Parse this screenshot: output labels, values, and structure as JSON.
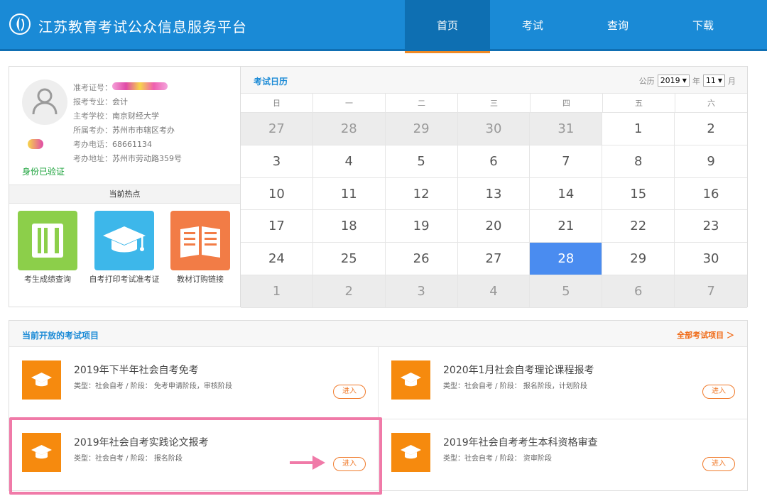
{
  "header": {
    "title": "江苏教育考试公众信息服务平台",
    "nav": [
      "首页",
      "考试",
      "查询",
      "下载"
    ],
    "active_nav": 0,
    "brand_color": "#1a8ad6"
  },
  "profile": {
    "fields": [
      {
        "label": "准考证号：",
        "value": ""
      },
      {
        "label": "报考专业：",
        "value": "会计"
      },
      {
        "label": "主考学校：",
        "value": "南京财经大学"
      },
      {
        "label": "所属考办：",
        "value": "苏州市市辖区考办"
      },
      {
        "label": "考办电话：",
        "value": "68661134"
      },
      {
        "label": "考办地址：",
        "value": "苏州市劳动路359号"
      }
    ],
    "verified": "身份已验证",
    "hot_title": "当前热点",
    "hot_items": [
      {
        "label": "考生成绩查询",
        "icon": "notebook-icon",
        "color": "#8ccf4a"
      },
      {
        "label": "自考打印考试准考证",
        "icon": "graduation-cap-icon",
        "color": "#3db7ea"
      },
      {
        "label": "教材订购链接",
        "icon": "open-book-icon",
        "color": "#f27c46"
      }
    ]
  },
  "calendar": {
    "title": "考试日历",
    "calendar_type": "公历",
    "year": "2019",
    "year_suffix": "年",
    "month": "11",
    "month_suffix": "月",
    "weekdays": [
      "日",
      "一",
      "二",
      "三",
      "四",
      "五",
      "六"
    ],
    "days": [
      {
        "d": "27",
        "t": "other"
      },
      {
        "d": "28",
        "t": "other"
      },
      {
        "d": "29",
        "t": "other"
      },
      {
        "d": "30",
        "t": "other"
      },
      {
        "d": "31",
        "t": "other"
      },
      {
        "d": "1",
        "t": ""
      },
      {
        "d": "2",
        "t": ""
      },
      {
        "d": "3",
        "t": ""
      },
      {
        "d": "4",
        "t": ""
      },
      {
        "d": "5",
        "t": ""
      },
      {
        "d": "6",
        "t": ""
      },
      {
        "d": "7",
        "t": ""
      },
      {
        "d": "8",
        "t": ""
      },
      {
        "d": "9",
        "t": ""
      },
      {
        "d": "10",
        "t": ""
      },
      {
        "d": "11",
        "t": ""
      },
      {
        "d": "12",
        "t": ""
      },
      {
        "d": "13",
        "t": ""
      },
      {
        "d": "14",
        "t": ""
      },
      {
        "d": "15",
        "t": ""
      },
      {
        "d": "16",
        "t": ""
      },
      {
        "d": "17",
        "t": ""
      },
      {
        "d": "18",
        "t": ""
      },
      {
        "d": "19",
        "t": ""
      },
      {
        "d": "20",
        "t": ""
      },
      {
        "d": "21",
        "t": ""
      },
      {
        "d": "22",
        "t": ""
      },
      {
        "d": "23",
        "t": ""
      },
      {
        "d": "24",
        "t": ""
      },
      {
        "d": "25",
        "t": ""
      },
      {
        "d": "26",
        "t": ""
      },
      {
        "d": "27",
        "t": ""
      },
      {
        "d": "28",
        "t": "today"
      },
      {
        "d": "29",
        "t": ""
      },
      {
        "d": "30",
        "t": ""
      },
      {
        "d": "1",
        "t": "other"
      },
      {
        "d": "2",
        "t": "other"
      },
      {
        "d": "3",
        "t": "other"
      },
      {
        "d": "4",
        "t": "other"
      },
      {
        "d": "5",
        "t": "other"
      },
      {
        "d": "6",
        "t": "other"
      },
      {
        "d": "7",
        "t": "other"
      }
    ],
    "today_color": "#4a8cf0"
  },
  "exams": {
    "title": "当前开放的考试项目",
    "all_link": "全部考试项目 ＞",
    "items": [
      {
        "title": "2019年下半年社会自考免考",
        "meta": "类型：社会自考 / 阶段： 免考申请阶段，审核阶段",
        "button": "进入"
      },
      {
        "title": "2020年1月社会自考理论课程报考",
        "meta": "类型：社会自考 / 阶段： 报名阶段，计划阶段",
        "button": "进入"
      },
      {
        "title": "2019年社会自考实践论文报考",
        "meta": "类型：社会自考 / 阶段： 报名阶段",
        "button": "进入"
      },
      {
        "title": "2019年社会自考考生本科资格审查",
        "meta": "类型：社会自考 / 阶段： 资审阶段",
        "button": "进入"
      }
    ],
    "icon": "graduation-cap-icon",
    "icon_color": "#f68a0e",
    "highlight_color": "#f07aa8"
  }
}
